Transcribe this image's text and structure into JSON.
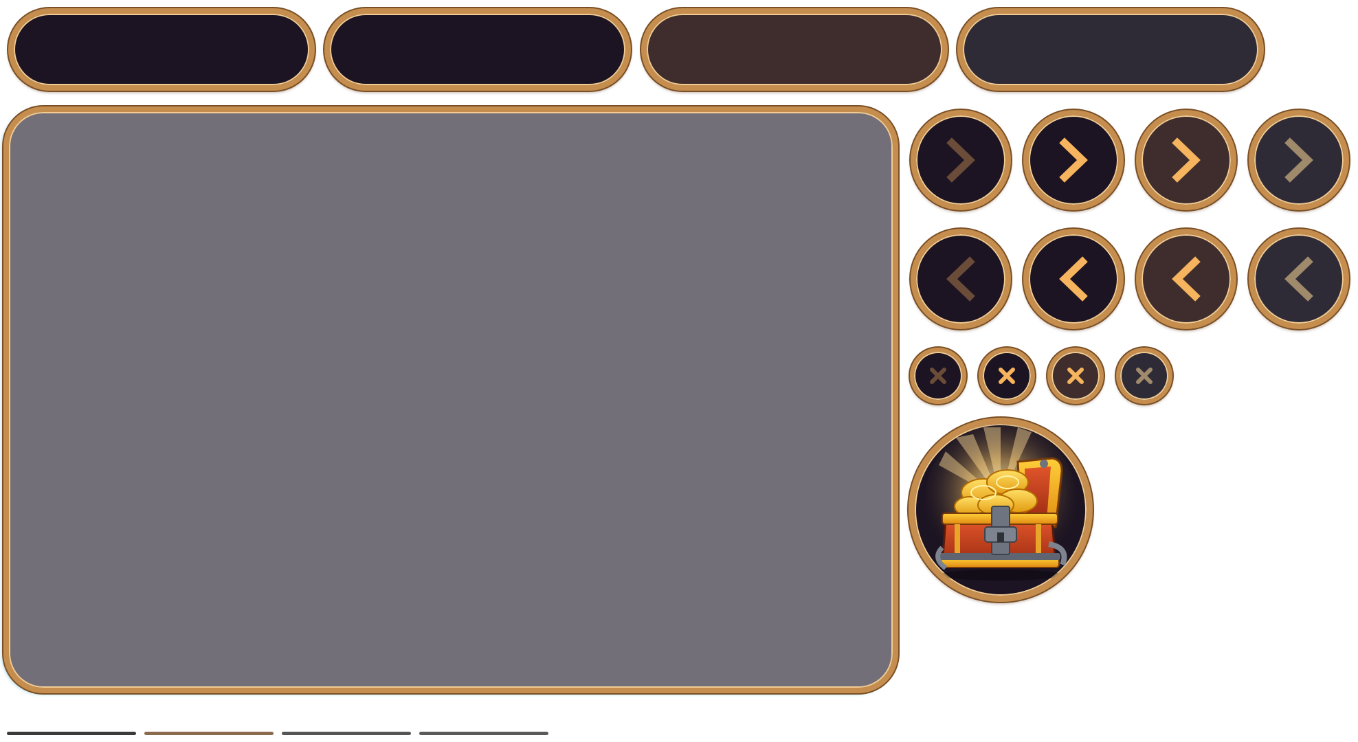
{
  "colors": {
    "frame_gold": "#c58e4e",
    "frame_highlight": "#f2cc94",
    "frame_shadow": "#7a4f26",
    "panel_fill": "#736f78",
    "state_fills": [
      "#1c1422",
      "#1c1422",
      "#3e2d2c",
      "#2f2b36"
    ],
    "glyph_colors": [
      "#6b4c39",
      "#f6b45e",
      "#f6b45e",
      "#a08a6c"
    ],
    "bar_colors": [
      "#3a3a3a",
      "#8a6b4e",
      "#555555",
      "#5a5a5a"
    ]
  },
  "buttons": {
    "pills": [
      {
        "state": "normal",
        "fill": "#1c1422"
      },
      {
        "state": "hover",
        "fill": "#1c1422"
      },
      {
        "state": "pressed",
        "fill": "#3e2d2c"
      },
      {
        "state": "disabled",
        "fill": "#2f2b36"
      }
    ],
    "next_icon": "chevron-right-icon",
    "prev_icon": "chevron-left-icon",
    "close_icon": "close-icon"
  },
  "reward": {
    "icon": "treasure-chest-icon"
  }
}
